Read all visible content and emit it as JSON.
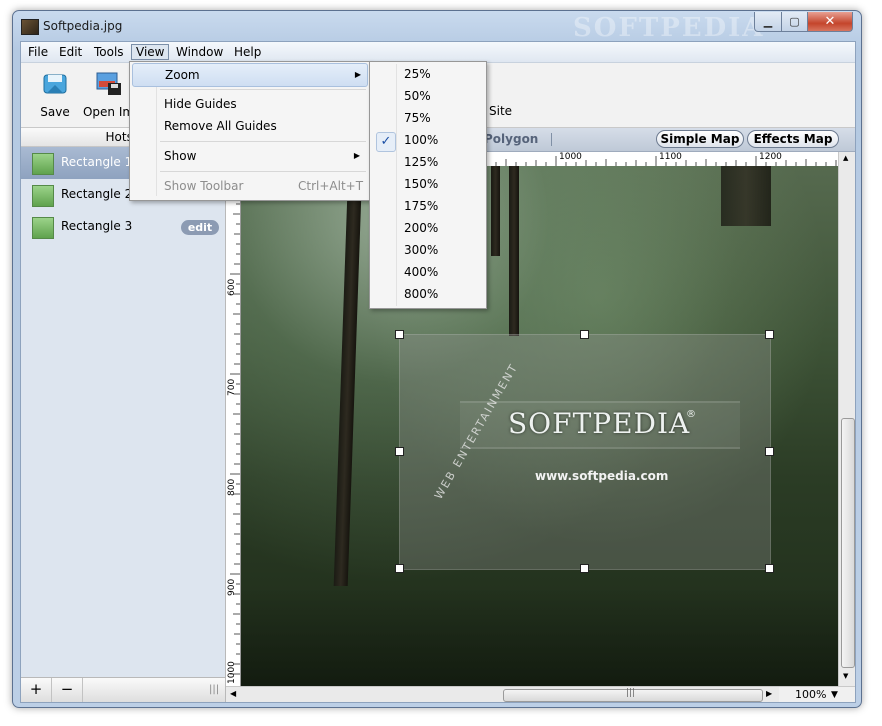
{
  "window": {
    "title": "Softpedia.jpg",
    "watermark": "SOFTPEDIA",
    "minimize": "▁",
    "maximize": "▢",
    "close": "✕"
  },
  "menubar": {
    "items": [
      "File",
      "Edit",
      "Tools",
      "View",
      "Window",
      "Help"
    ]
  },
  "toolbar": {
    "save": "Save",
    "open_image": "Open Imag",
    "site": "Site"
  },
  "sidebar": {
    "header": "Hotsp",
    "items": [
      {
        "label": "Rectangle 1",
        "selected": true
      },
      {
        "label": "Rectangle 2",
        "selected": false
      },
      {
        "label": "Rectangle 3",
        "selected": false
      }
    ],
    "edit_label": "edit",
    "add": "+",
    "remove": "−",
    "grip": "|||"
  },
  "mapbar": {
    "polygon": "Polygon",
    "simple_map": "Simple Map",
    "effects_map": "Effects Map"
  },
  "rulers": {
    "horizontal": [
      "1000",
      "1100",
      "1200"
    ],
    "vertical": [
      "600",
      "700",
      "800",
      "900",
      "1000"
    ]
  },
  "image": {
    "logo": "SOFTPEDIA",
    "reg": "®",
    "url": "www.softpedia.com",
    "tagline": "WEB ENTERTAINMENT"
  },
  "view_menu": {
    "zoom": "Zoom",
    "hide_guides": "Hide Guides",
    "remove_all_guides": "Remove All Guides",
    "show": "Show",
    "show_toolbar": "Show Toolbar",
    "show_toolbar_shortcut": "Ctrl+Alt+T",
    "arrow": "▶"
  },
  "zoom_menu": {
    "options": [
      "25%",
      "50%",
      "75%",
      "100%",
      "125%",
      "150%",
      "175%",
      "200%",
      "300%",
      "400%",
      "800%"
    ],
    "selected": "100%",
    "check": "✓"
  },
  "status": {
    "zoom_value": "100%",
    "zoom_arrow": "▼",
    "scroll_grip": "|||",
    "left_arrow": "◀",
    "right_arrow": "▶"
  },
  "colors": {
    "selection_blue": "#8ea2bf",
    "window_frame": "#b4c9e2",
    "close_red": "#c4452c"
  }
}
